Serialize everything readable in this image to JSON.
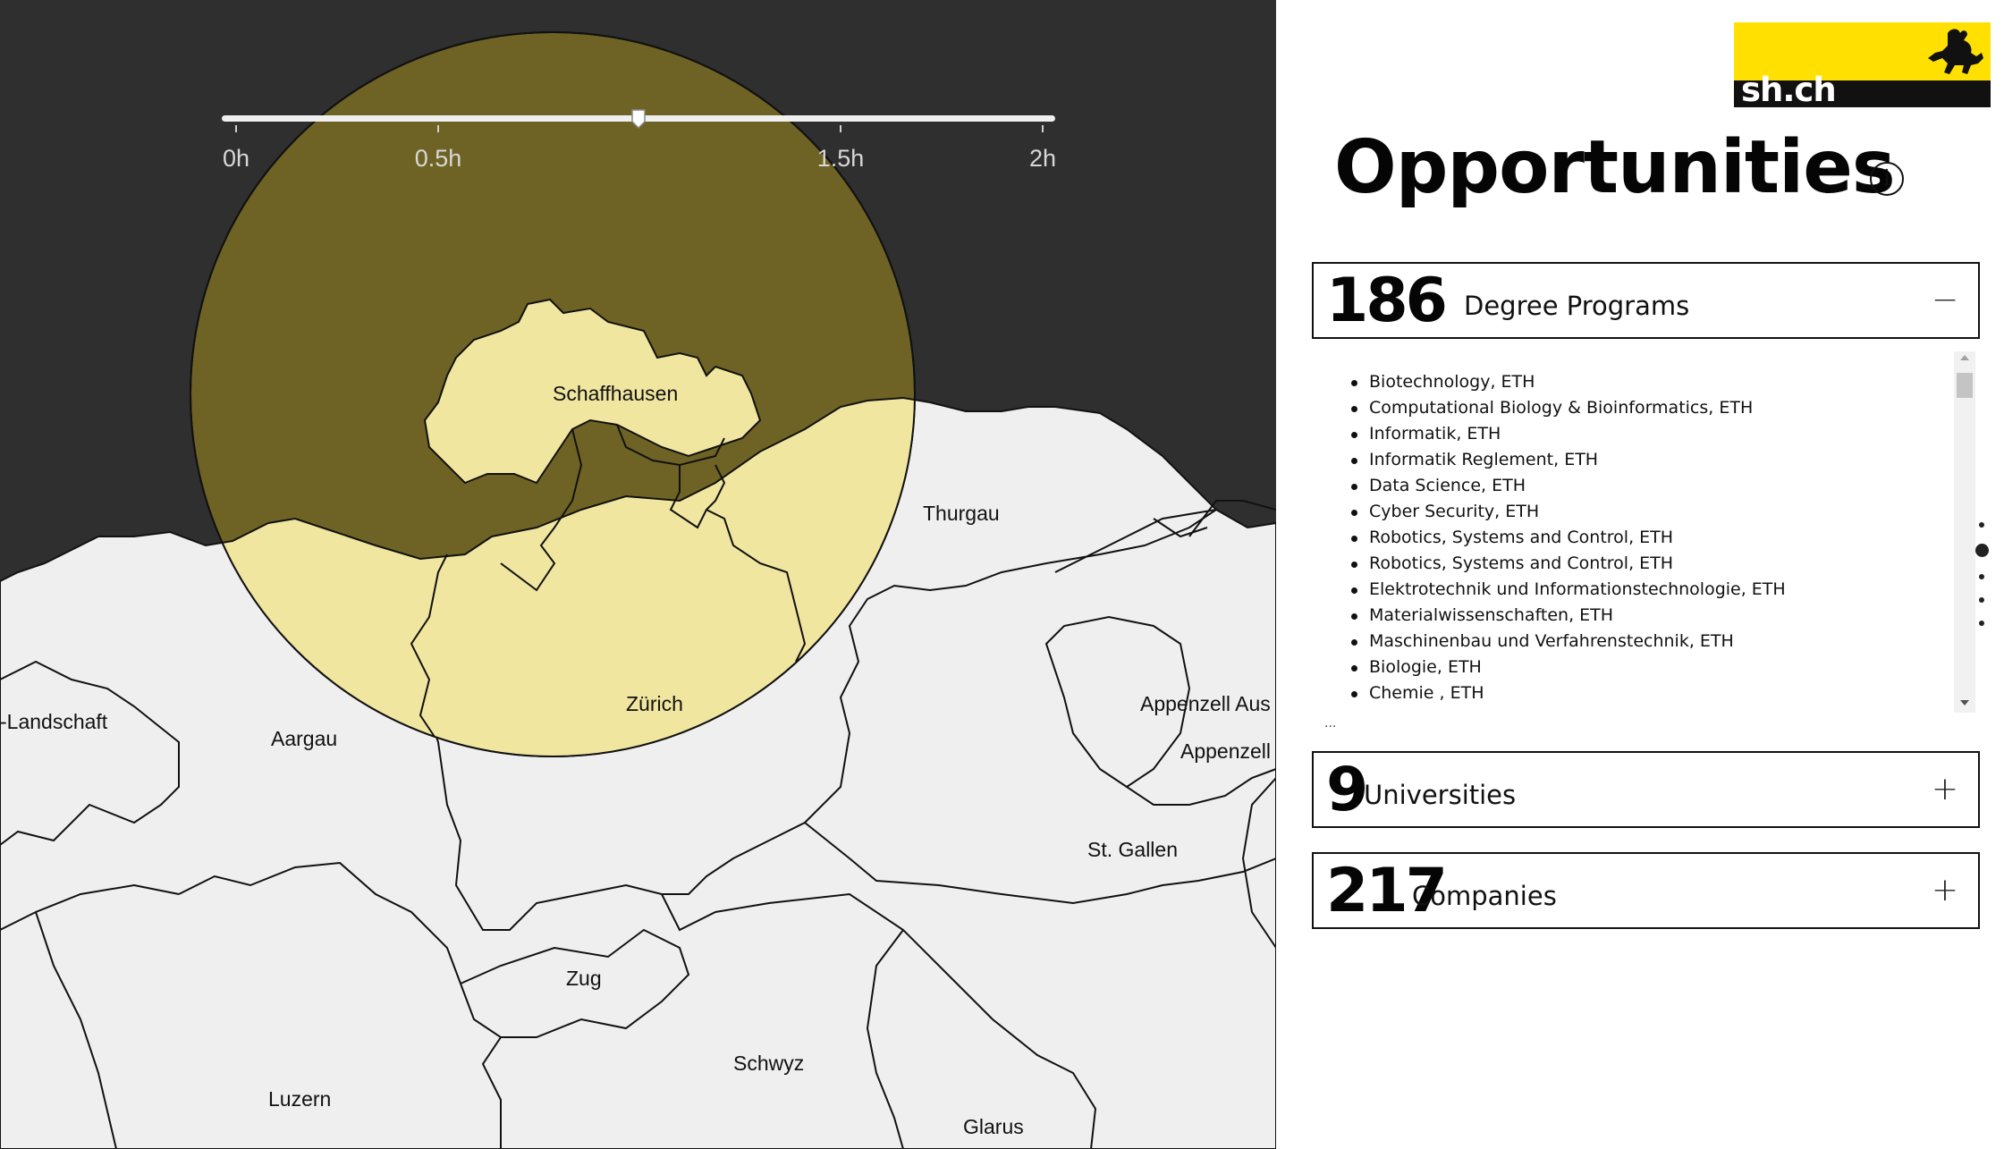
{
  "map": {
    "background_color": "#2f2f2f",
    "land_color": "#efefef",
    "reach_circle_color": "#f0e6a0",
    "highlight_color": "#e8d870",
    "canton_labels": [
      {
        "id": "schaffhausen",
        "text": "Schaffhausen"
      },
      {
        "id": "zurich",
        "text": "Zürich"
      },
      {
        "id": "thurgau",
        "text": "Thurgau"
      },
      {
        "id": "aargau",
        "text": "Aargau"
      },
      {
        "id": "basel-landschaft",
        "text": "-Landschaft"
      },
      {
        "id": "appenzell-ausserrhoden",
        "text": "Appenzell Aus"
      },
      {
        "id": "appenzell-innerrhoden",
        "text": "Appenzell"
      },
      {
        "id": "st-gallen",
        "text": "St. Gallen"
      },
      {
        "id": "zug",
        "text": "Zug"
      },
      {
        "id": "schwyz",
        "text": "Schwyz"
      },
      {
        "id": "luzern",
        "text": "Luzern"
      },
      {
        "id": "glarus",
        "text": "Glarus"
      }
    ]
  },
  "travel_time_slider": {
    "ticks": [
      "0h",
      "0.5h",
      "1.5h",
      "2h"
    ],
    "value_hours": 1.0,
    "range_hours": [
      0,
      2
    ]
  },
  "logo": {
    "text": "sh.ch",
    "icon": "ibex-icon",
    "colors": {
      "top": "#ffe000",
      "bottom": "#111111"
    }
  },
  "header": {
    "title": "Opportunities",
    "info_icon": "info-icon"
  },
  "sections": {
    "degree_programs": {
      "count": "186",
      "label": "Degree Programs",
      "toggle": "−",
      "expanded": true,
      "items": [
        "Biotechnology, ETH",
        "Computational Biology & Bioinformatics, ETH",
        "Informatik, ETH",
        "Informatik Reglement, ETH",
        "Data Science, ETH",
        "Cyber Security, ETH",
        "Robotics, Systems and Control, ETH",
        "Robotics, Systems and Control, ETH",
        "Elektrotechnik und Informationstechnologie, ETH",
        "Materialwissenschaften, ETH",
        "Maschinenbau und Verfahrenstechnik, ETH",
        "Biologie, ETH",
        "Chemie , ETH"
      ],
      "more": "..."
    },
    "universities": {
      "count": "9",
      "label": "Universities",
      "toggle": "+",
      "expanded": false
    },
    "companies": {
      "count": "217",
      "label": "Companies",
      "toggle": "+",
      "expanded": false
    }
  },
  "pagination": {
    "pages": 5,
    "active_index": 1
  }
}
